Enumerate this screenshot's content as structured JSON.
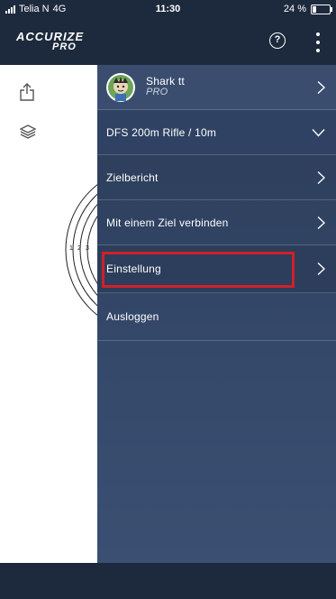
{
  "status_bar": {
    "carrier": "Telia N",
    "network": "4G",
    "time": "11:30",
    "battery_text": "24 %",
    "battery_level": 0.24
  },
  "header": {
    "logo_top": "ACCURIZE",
    "logo_bottom": "PRO",
    "help_icon": "question-circle-icon",
    "help_glyph": "?",
    "more_icon": "vertical-dots-icon"
  },
  "left_panel": {
    "share_icon": "share-icon",
    "layers_icon": "layers-icon",
    "ring_labels": [
      "1",
      "2",
      "3"
    ]
  },
  "drawer": {
    "profile": {
      "name": "Shark tt",
      "tier": "PRO"
    },
    "dfs_selector": "DFS 200m Rifle / 10m",
    "items": [
      {
        "label": "Zielbericht"
      },
      {
        "label": "Mit einem Ziel verbinden"
      },
      {
        "label": "Einstellung"
      },
      {
        "label": "Ausloggen"
      }
    ]
  },
  "colors": {
    "header_bg": "#1d2a3d",
    "drawer_bg": "#34486a",
    "highlight": "#d0202a"
  }
}
